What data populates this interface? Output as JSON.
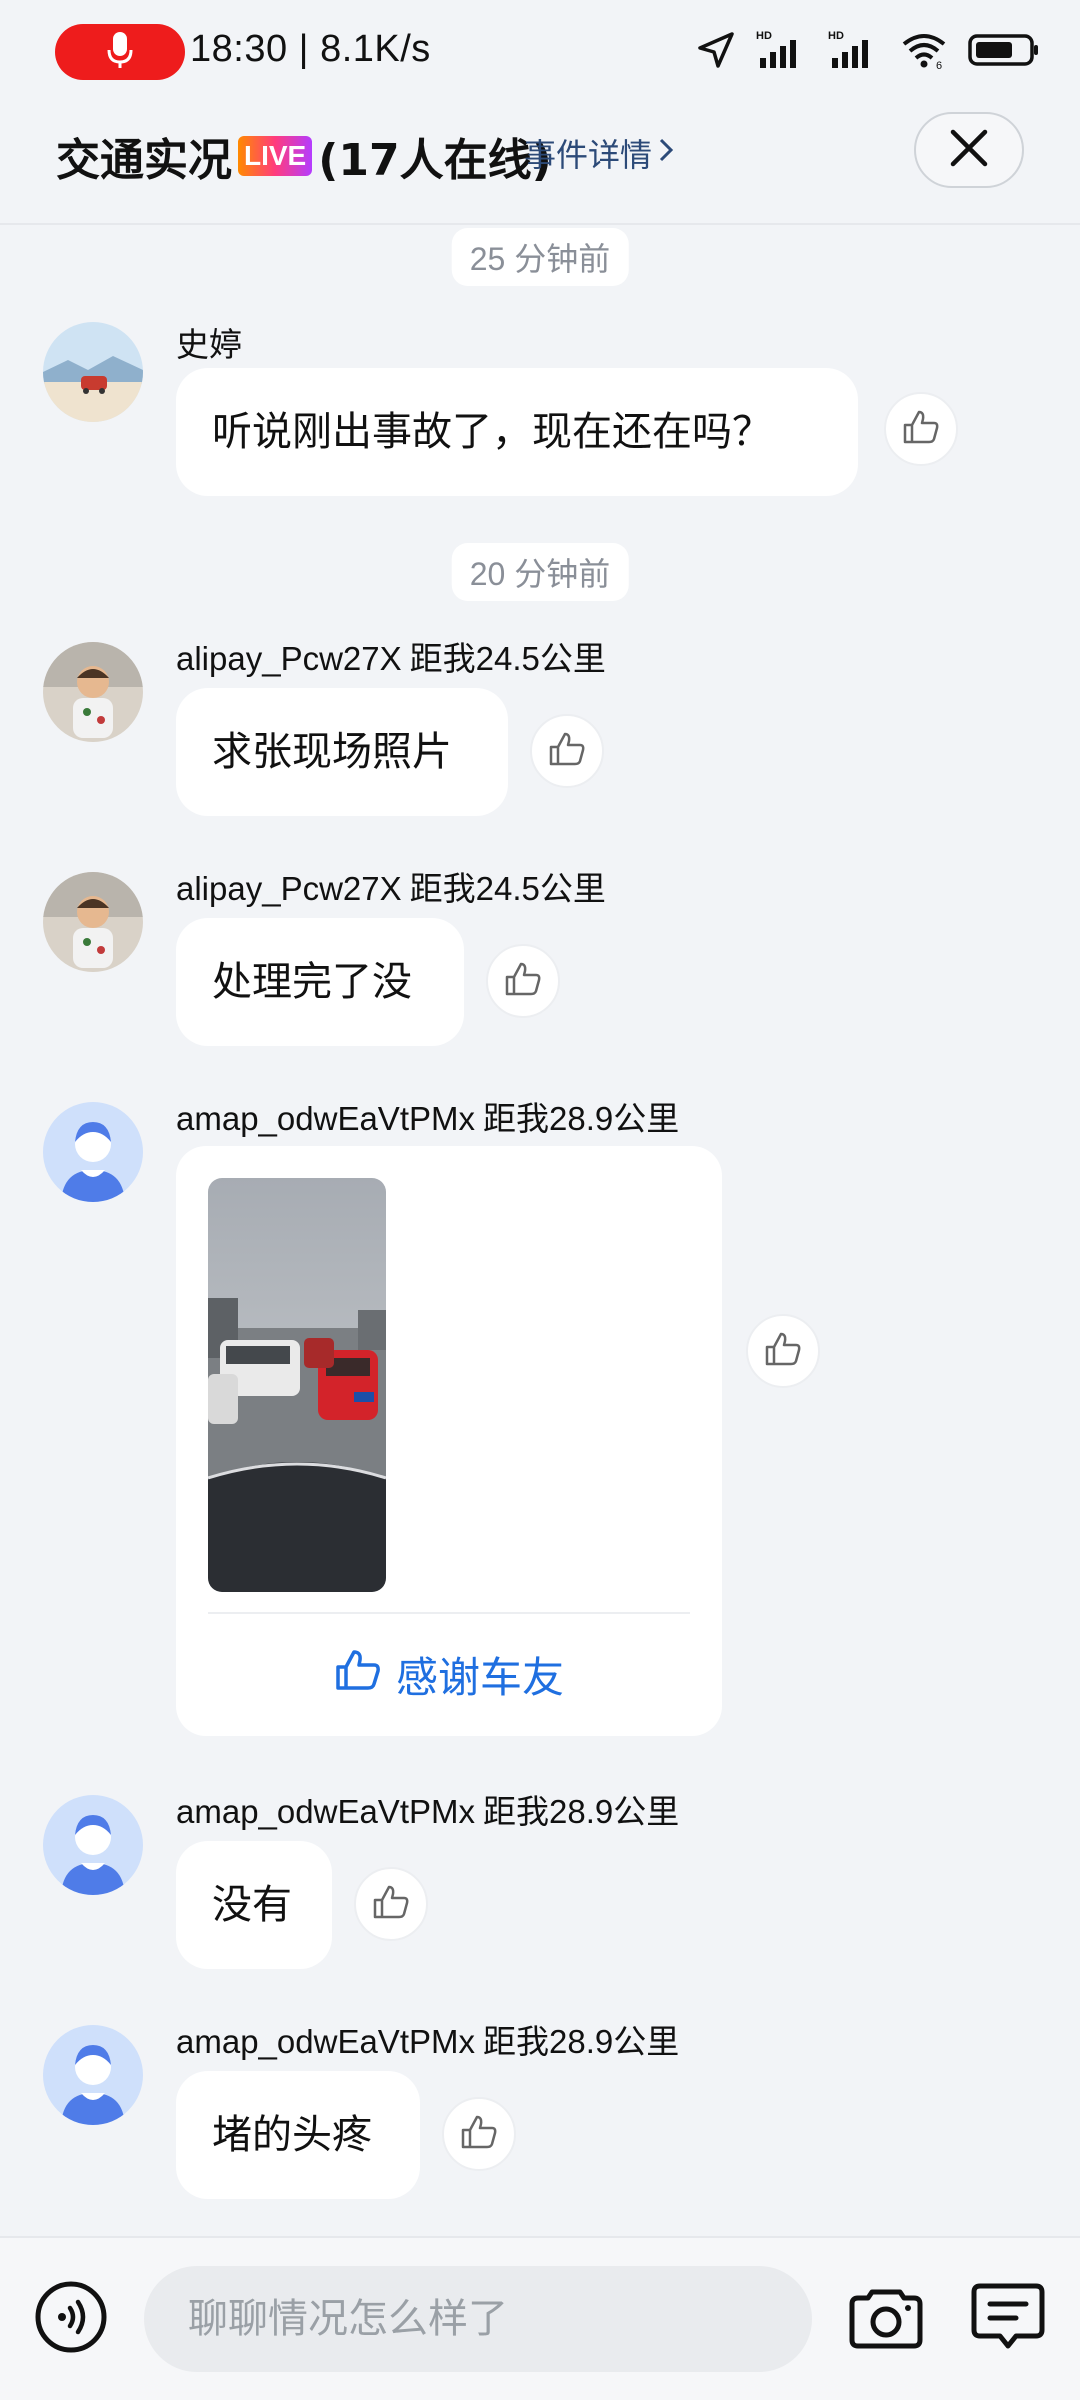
{
  "status_bar": {
    "time_speed": "18:30 | 8.1K/s",
    "hd_label_1": "HD",
    "hd_label_2": "HD",
    "wifi_label": "6",
    "icons": [
      "mic-icon",
      "location-arrow-icon",
      "signal-icon",
      "signal-icon",
      "wifi-icon",
      "battery-icon"
    ]
  },
  "header": {
    "title": "交通实况",
    "live_badge": "LIVE",
    "online_count": "(17人在线)",
    "detail_link": "事件详情",
    "close_icon": "close-icon"
  },
  "separators": [
    {
      "label": "25 分钟前"
    },
    {
      "label": "20 分钟前"
    }
  ],
  "messages": [
    {
      "username": "史婷",
      "distance": "",
      "text": "听说刚出事故了，现在还在吗？",
      "avatar": "landscape-car-avatar"
    },
    {
      "username": "alipay_Pcw27X",
      "distance": "距我24.5公里",
      "text": "求张现场照片",
      "avatar": "child-photo-avatar"
    },
    {
      "username": "alipay_Pcw27X",
      "distance": "距我24.5公里",
      "text": "处理完了没",
      "avatar": "child-photo-avatar"
    },
    {
      "username": "amap_odwEaVtPMx",
      "distance": "距我28.9公里",
      "photo_card": {
        "thanks_label": "感谢车友"
      },
      "avatar": "default-user-avatar"
    },
    {
      "username": "amap_odwEaVtPMx",
      "distance": "距我28.9公里",
      "text": "没有",
      "avatar": "default-user-avatar"
    },
    {
      "username": "amap_odwEaVtPMx",
      "distance": "距我28.9公里",
      "text": "堵的头疼",
      "avatar": "default-user-avatar"
    }
  ],
  "bottom_bar": {
    "input_placeholder": "聊聊情况怎么样了",
    "icons": [
      "voice-icon",
      "camera-icon",
      "comment-icon"
    ]
  },
  "colors": {
    "background": "#f2f4f7",
    "accent_blue": "#1f6fe0",
    "record_red": "#ee1c1c",
    "link_blue": "#2c4a78"
  }
}
